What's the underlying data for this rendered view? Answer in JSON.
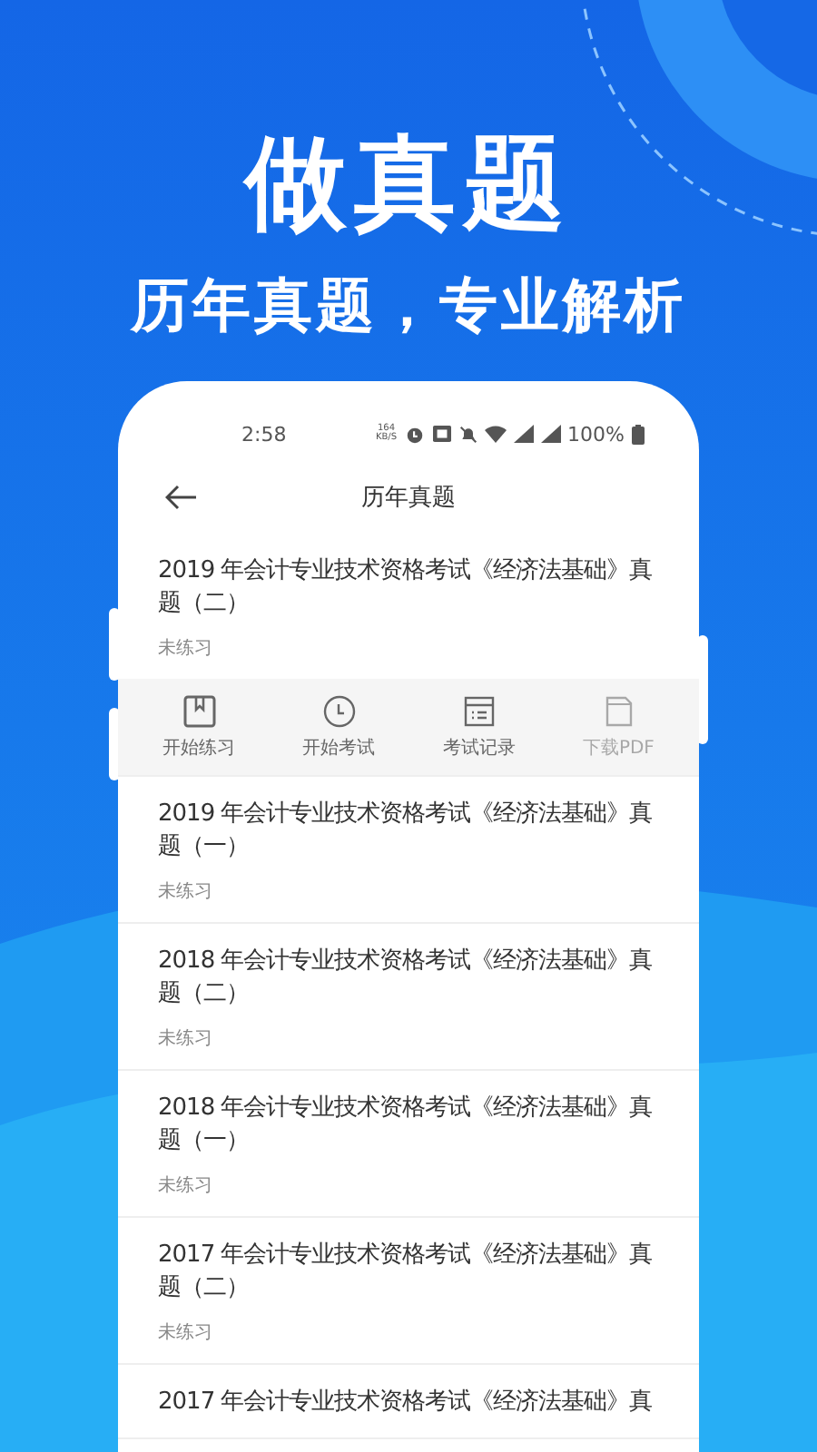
{
  "headline": "做真题",
  "subtitle": "历年真题，专业解析",
  "status_bar": {
    "time": "2:58",
    "speed_value": "164",
    "speed_unit": "KB/S",
    "battery": "100%"
  },
  "header": {
    "title": "历年真题"
  },
  "items": [
    {
      "title": "2019 年会计专业技术资格考试《经济法基础》真题（二）",
      "status": "未练习",
      "expanded": true
    },
    {
      "title": "2019 年会计专业技术资格考试《经济法基础》真题（一）",
      "status": "未练习",
      "expanded": false
    },
    {
      "title": "2018 年会计专业技术资格考试《经济法基础》真题（二）",
      "status": "未练习",
      "expanded": false
    },
    {
      "title": "2018 年会计专业技术资格考试《经济法基础》真题（一）",
      "status": "未练习",
      "expanded": false
    },
    {
      "title": "2017 年会计专业技术资格考试《经济法基础》真题（二）",
      "status": "未练习",
      "expanded": false
    },
    {
      "title": "2017 年会计专业技术资格考试《经济法基础》真",
      "expanded": false
    }
  ],
  "actions": [
    {
      "kind": "practice",
      "label": "开始练习",
      "disabled": false
    },
    {
      "kind": "exam",
      "label": "开始考试",
      "disabled": false
    },
    {
      "kind": "records",
      "label": "考试记录",
      "disabled": false
    },
    {
      "kind": "pdf",
      "label": "下载PDF",
      "disabled": true
    }
  ]
}
